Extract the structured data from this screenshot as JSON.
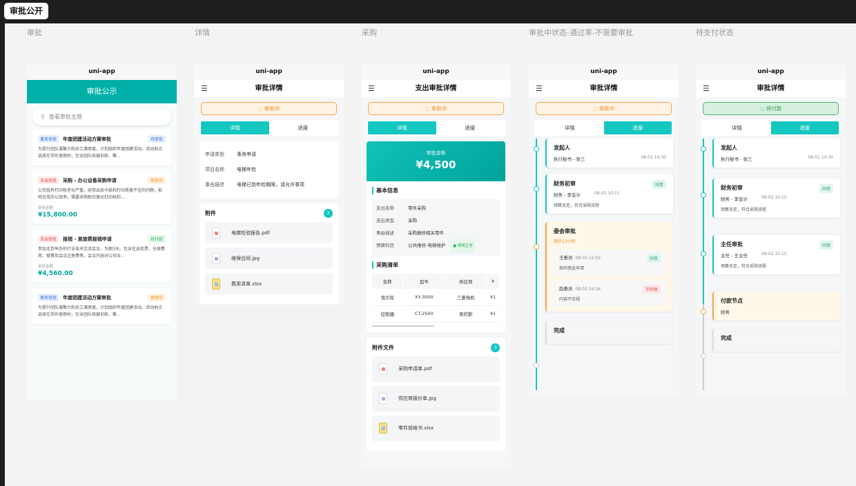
{
  "window": {
    "badge": "审批公开"
  },
  "frames": [
    "审批",
    "详情",
    "采购",
    "审批中状态-通过率-不需要审批",
    "待支付状态"
  ],
  "app_name": "uni-app",
  "list": {
    "header": "审批公示",
    "search_placeholder": "查看审批主题",
    "amount_label": "审批金额",
    "items": [
      {
        "tag": "事务审批",
        "title": "年度团建活动方案审批",
        "status": "待审批",
        "desc": "为提升团队凝聚力和员工满意度，计划组织年度团建活动。活动地点选择在郊外度假村，包含团队拓展训练、聚...",
        "amount": ""
      },
      {
        "tag": "支出审批",
        "title": "采购 - 办公设备采购申请",
        "status": "审批中",
        "desc": "公司现有打印机老化严重，经常出现卡纸和打印质量不佳的问题，影响日常办公效率。需要采购新的激光打印机和...",
        "amount": "¥15,800.00"
      },
      {
        "tag": "支出审批",
        "title": "报销 - 差旅费报销申请",
        "status": "待付款",
        "desc": "参加北京举办的行业技术交流会议，为期3天。包含往返机票、住宿费用、餐费及会议注册费等。会议内容对公司业...",
        "amount": "¥4,560.00"
      },
      {
        "tag": "事务审批",
        "title": "年度团建活动方案审批",
        "status": "审批中",
        "desc": "为提升团队凝聚力和员工满意度，计划组织年度团建活动。活动地点选择在郊外度假村，包含团队拓展训练、聚...",
        "amount": ""
      }
    ]
  },
  "detail": {
    "title": "审批详情",
    "status": "审批中",
    "tab_detail": "详情",
    "tab_progress": "进度",
    "fields": [
      {
        "k": "申请类型",
        "v": "事务申请"
      },
      {
        "k": "项目名称",
        "v": "电梯年检"
      },
      {
        "k": "事由描述",
        "v": "电梯已到年检期限，请允许事项"
      }
    ],
    "files_title": "附件",
    "files_count": "3",
    "files": [
      "电梯检验报告.pdf",
      "维保合同.jpg",
      "费用清单.xlsx"
    ]
  },
  "purchase": {
    "title": "支出审批详情",
    "status": "审批中",
    "amount_label": "审批金额",
    "amount": "¥4,500",
    "basic_title": "基本信息",
    "fields": [
      {
        "k": "支出名称",
        "v": "零件采购"
      },
      {
        "k": "支出类型",
        "v": "采购"
      },
      {
        "k": "事由描述",
        "v": "采购报修相关零件"
      },
      {
        "k": "预算科目",
        "v": "公共维修-电梯维护"
      }
    ],
    "budget_badge": "● 预算正常",
    "list_title": "采购清单",
    "table_headers": [
      "名称",
      "型号",
      "供应商",
      "¥"
    ],
    "table_rows": [
      [
        "曳引轮",
        "XY-3000",
        "三菱电机",
        "¥1"
      ],
      [
        "控制器",
        "CT-2500",
        "奥的斯",
        "¥1"
      ]
    ],
    "files_title": "附件文件",
    "files_count": "3",
    "files": [
      "采购申请单.pdf",
      "供应商报价单.jpg",
      "零件规格书.xlsx"
    ]
  },
  "progress": {
    "title": "审批详情",
    "status": "审批中",
    "n1_title": "发起人",
    "n1_person": "执行秘书 - 张三",
    "n1_date": "08-01 14:30",
    "n2_title": "财务初审",
    "n2_person": "财务 - 李会计",
    "n2_date": "08-02 10:15",
    "n2_note": "预算充足，符合采购流程",
    "n2_badge": "同意",
    "n3_title": "委会审批",
    "n3_remain": "剩余12小时",
    "v1_name": "王委员",
    "v1_date": "08-03 12:02",
    "v1_badge": "同意",
    "v1_comment": "我同意此申请",
    "v2_name": "赵委员",
    "v2_date": "08-03 14:34",
    "v2_badge": "不同意",
    "v2_comment": "内容不合规",
    "n4_title": "完成"
  },
  "pay": {
    "title": "审批详情",
    "status": "待付款",
    "n1_title": "发起人",
    "n1_person": "执行秘书 - 张三",
    "n1_date": "08-01 14:30",
    "n2_title": "财务初审",
    "n2_person": "财务 - 李会计",
    "n2_date": "08-02 10:15",
    "n2_note": "预算充足，符合采购流程",
    "n2_badge": "同意",
    "n3_title": "主任审批",
    "n3_person": "主任 - 王主任",
    "n3_date": "08-02 10:15",
    "n3_note": "预算充足，符合采购流程",
    "n3_badge": "同意",
    "n4_title": "付款节点",
    "n4_person": "财务",
    "n5_title": "完成"
  }
}
